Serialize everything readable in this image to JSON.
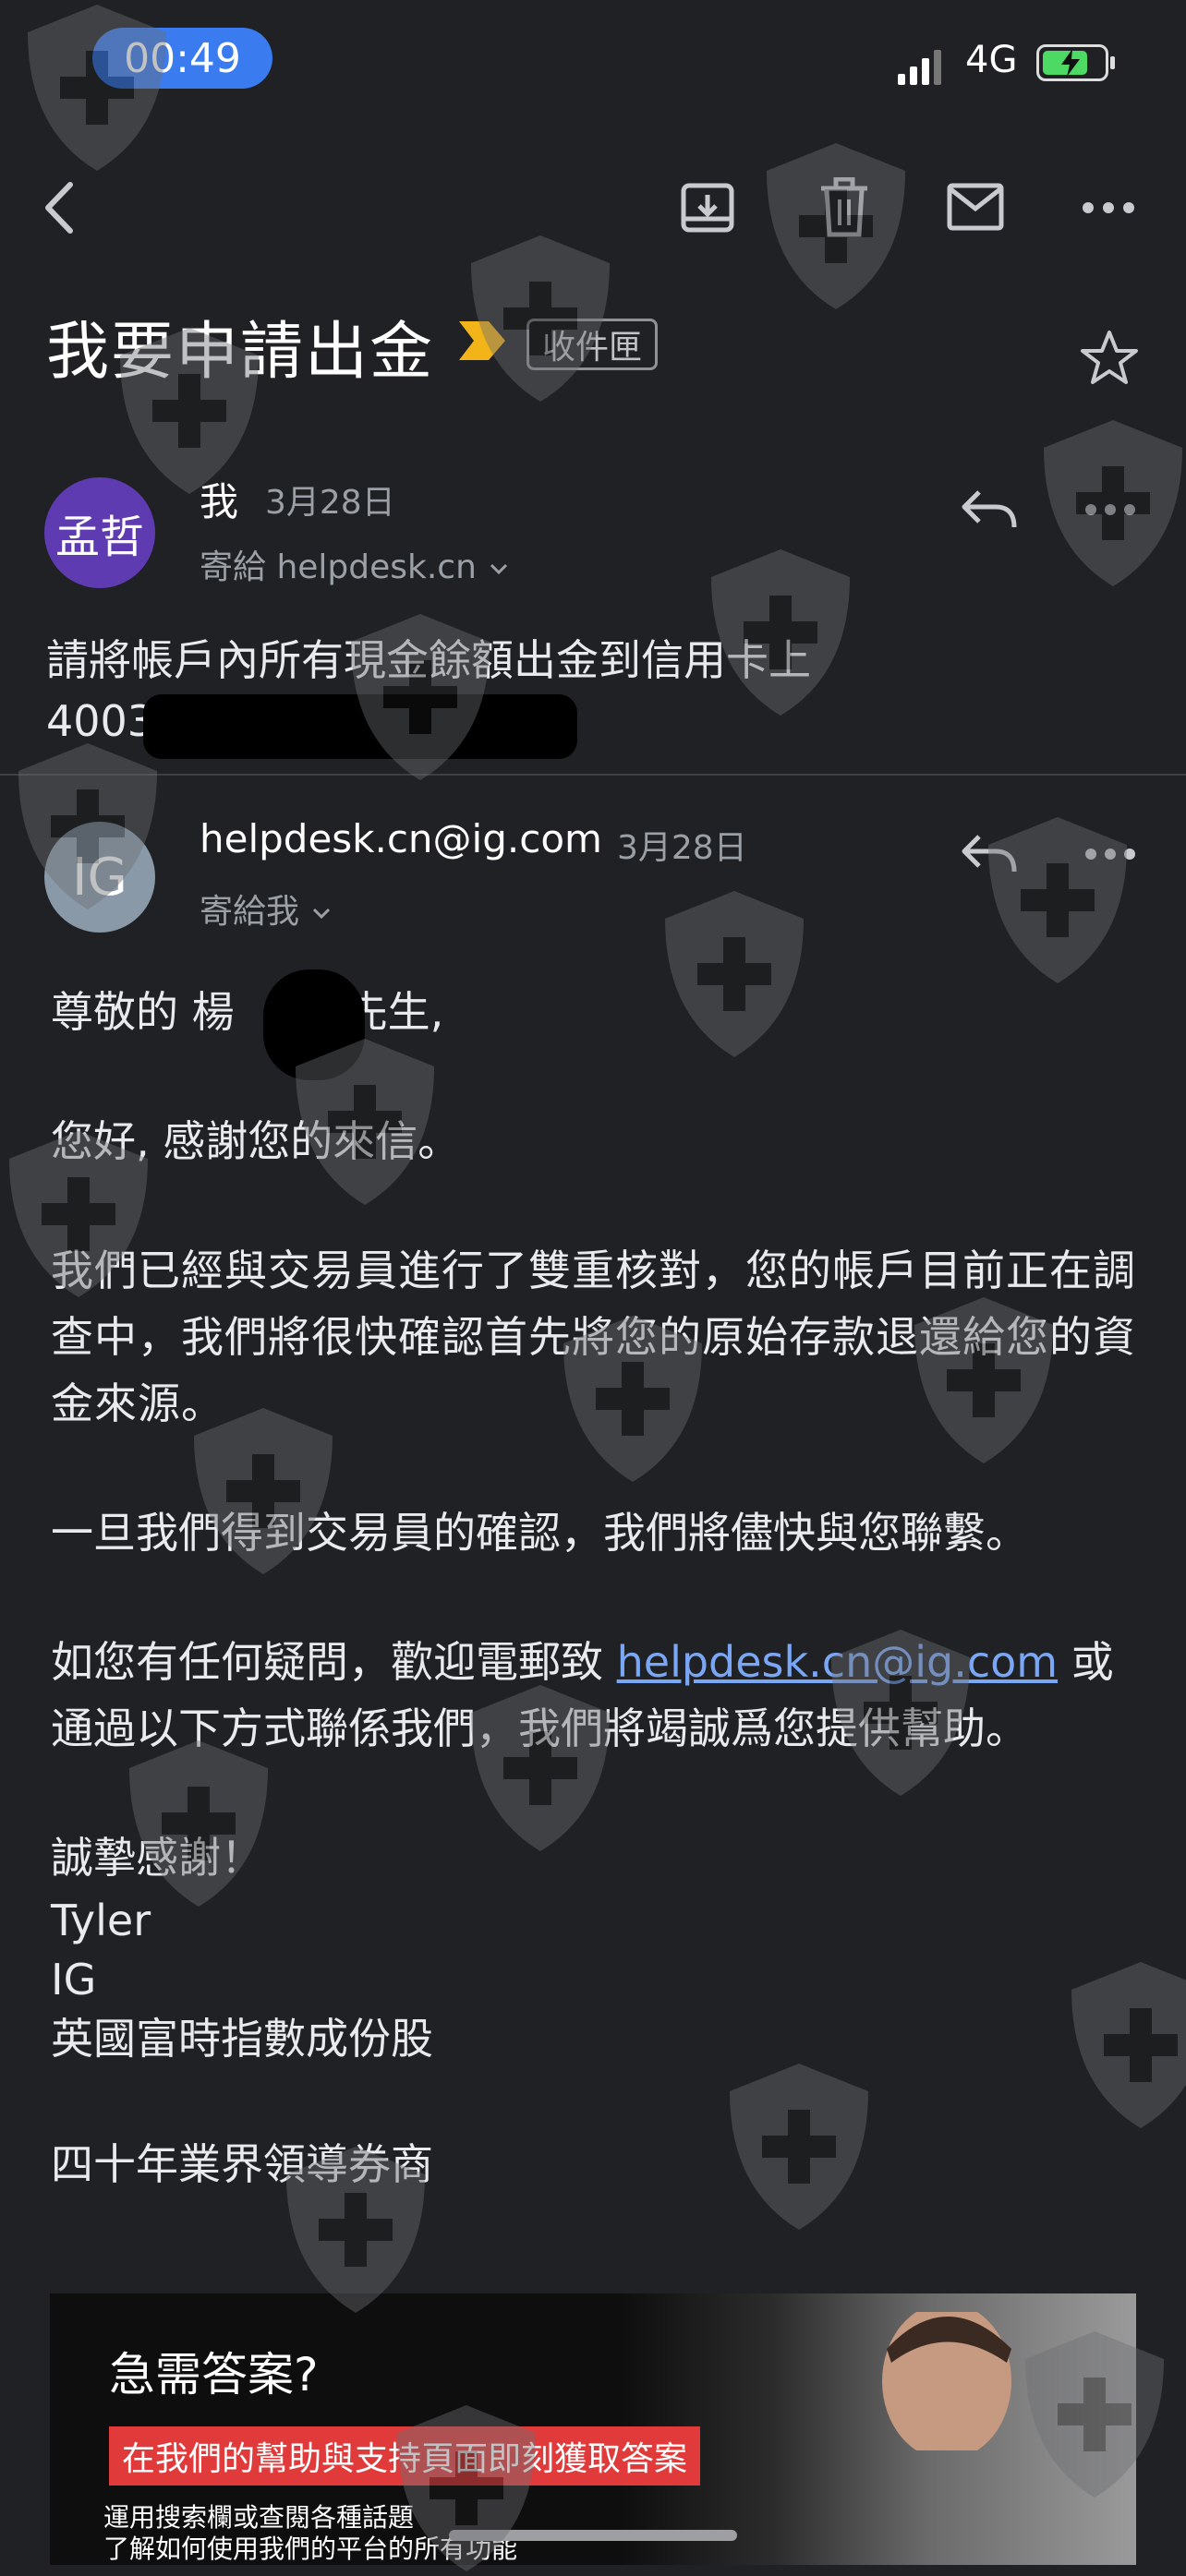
{
  "status_bar": {
    "time": "00:49",
    "network": "4G"
  },
  "toolbar": {
    "back_icon": "back-arrow-icon",
    "archive_icon": "archive-icon",
    "delete_icon": "trash-icon",
    "mark_unread_icon": "mail-icon",
    "more_icon": "more-icon"
  },
  "subject": {
    "title": "我要申請出金",
    "label": "收件匣"
  },
  "message1": {
    "avatar_text": "孟哲",
    "sender": "我",
    "date": "3月28日",
    "to": "寄給 helpdesk.cn",
    "body_line1": "請將帳戶內所有現金餘額出金到信用卡上",
    "body_line2": "4003"
  },
  "message2": {
    "avatar_text": "IG",
    "sender": "helpdesk.cn@ig.com",
    "date": "3月28日",
    "to": "寄給我",
    "greeting_a": "尊敬的 楊",
    "greeting_b": "先生,",
    "p1": "您好, 感謝您的來信。",
    "p2": "我們已經與交易員進行了雙重核對，您的帳戶目前正在調查中，我們將很快確認首先將您的原始存款退還給您的資金來源。",
    "p3": "一旦我們得到交易員的確認，我們將儘快與您聯繫。",
    "p4_a": "如您有任何疑問，歡迎電郵致",
    "p4_link": "helpdesk.cn@ig.com",
    "p4_b": "或通過以下方式聯係我們，我們將竭誠爲您提供幫助。",
    "thanks": "誠摯感謝！",
    "sig_name": "Tyler",
    "sig_company": "IG",
    "sig_line3": "英國富時指數成份股",
    "tagline": "四十年業界領導券商"
  },
  "banner": {
    "title": "急需答案?",
    "red_text": "在我們的幫助與支持頁面即刻獲取答案",
    "sub1": "運用搜索欄或查閱各種話題",
    "sub2": "了解如何使用我們的平台的所有功能"
  },
  "colors": {
    "background": "#202124",
    "accent_blue": "#3a7bf0",
    "link": "#7aa7f5",
    "avatar_me": "#5e3bb0",
    "avatar_ig": "#8a99a8",
    "important": "#f2b418",
    "banner_red": "#e03a3a"
  }
}
